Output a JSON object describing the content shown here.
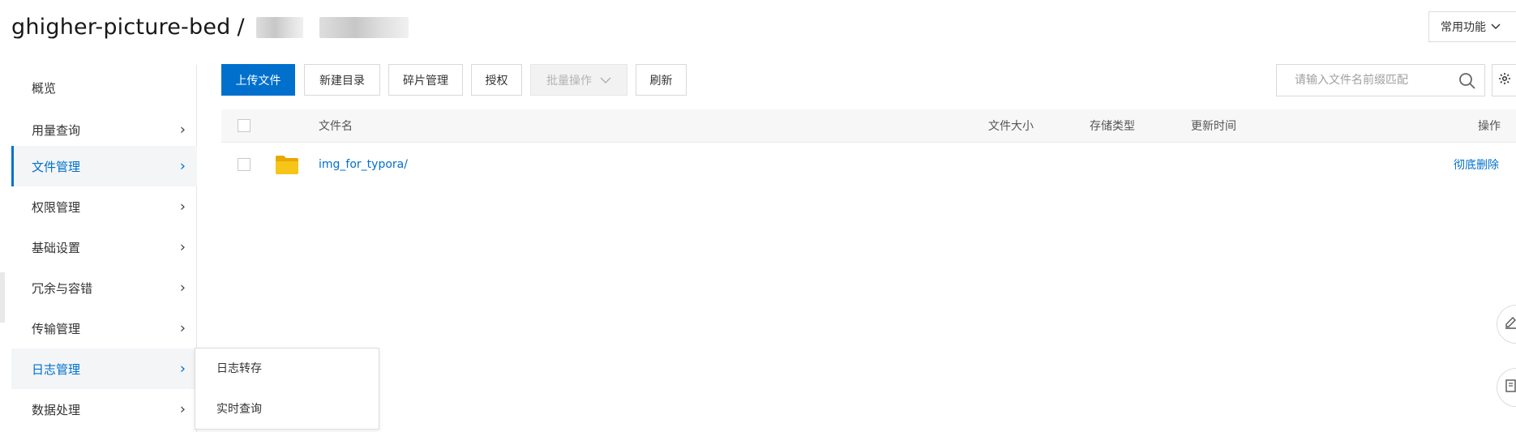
{
  "header": {
    "bucket_name": "ghigher-picture-bed",
    "separator": "/",
    "common_functions_label": "常用功能"
  },
  "sidebar": {
    "items": [
      {
        "label": "概览"
      },
      {
        "label": "用量查询"
      },
      {
        "label": "文件管理"
      },
      {
        "label": "权限管理"
      },
      {
        "label": "基础设置"
      },
      {
        "label": "冗余与容错"
      },
      {
        "label": "传输管理"
      },
      {
        "label": "日志管理"
      },
      {
        "label": "数据处理"
      }
    ],
    "active": "文件管理",
    "hovered": "日志管理"
  },
  "submenu": {
    "items": [
      {
        "label": "日志转存"
      },
      {
        "label": "实时查询"
      }
    ]
  },
  "toolbar": {
    "upload_label": "上传文件",
    "new_dir_label": "新建目录",
    "fragments_label": "碎片管理",
    "authorize_label": "授权",
    "batch_label": "批量操作",
    "refresh_label": "刷新"
  },
  "search": {
    "placeholder": "请输入文件名前缀匹配",
    "value": ""
  },
  "table": {
    "headers": {
      "name": "文件名",
      "size": "文件大小",
      "storage": "存储类型",
      "updated": "更新时间",
      "actions": "操作"
    },
    "rows": [
      {
        "name": "img_for_typora/",
        "size": "",
        "storage": "",
        "updated": "",
        "action": "彻底删除"
      }
    ]
  },
  "colors": {
    "accent": "#0070cc",
    "folder": "#f5c518"
  },
  "icons": [
    "chevron-down-icon",
    "chevron-right-icon",
    "search-icon",
    "gear-icon",
    "folder-icon",
    "edit-icon",
    "book-icon"
  ]
}
